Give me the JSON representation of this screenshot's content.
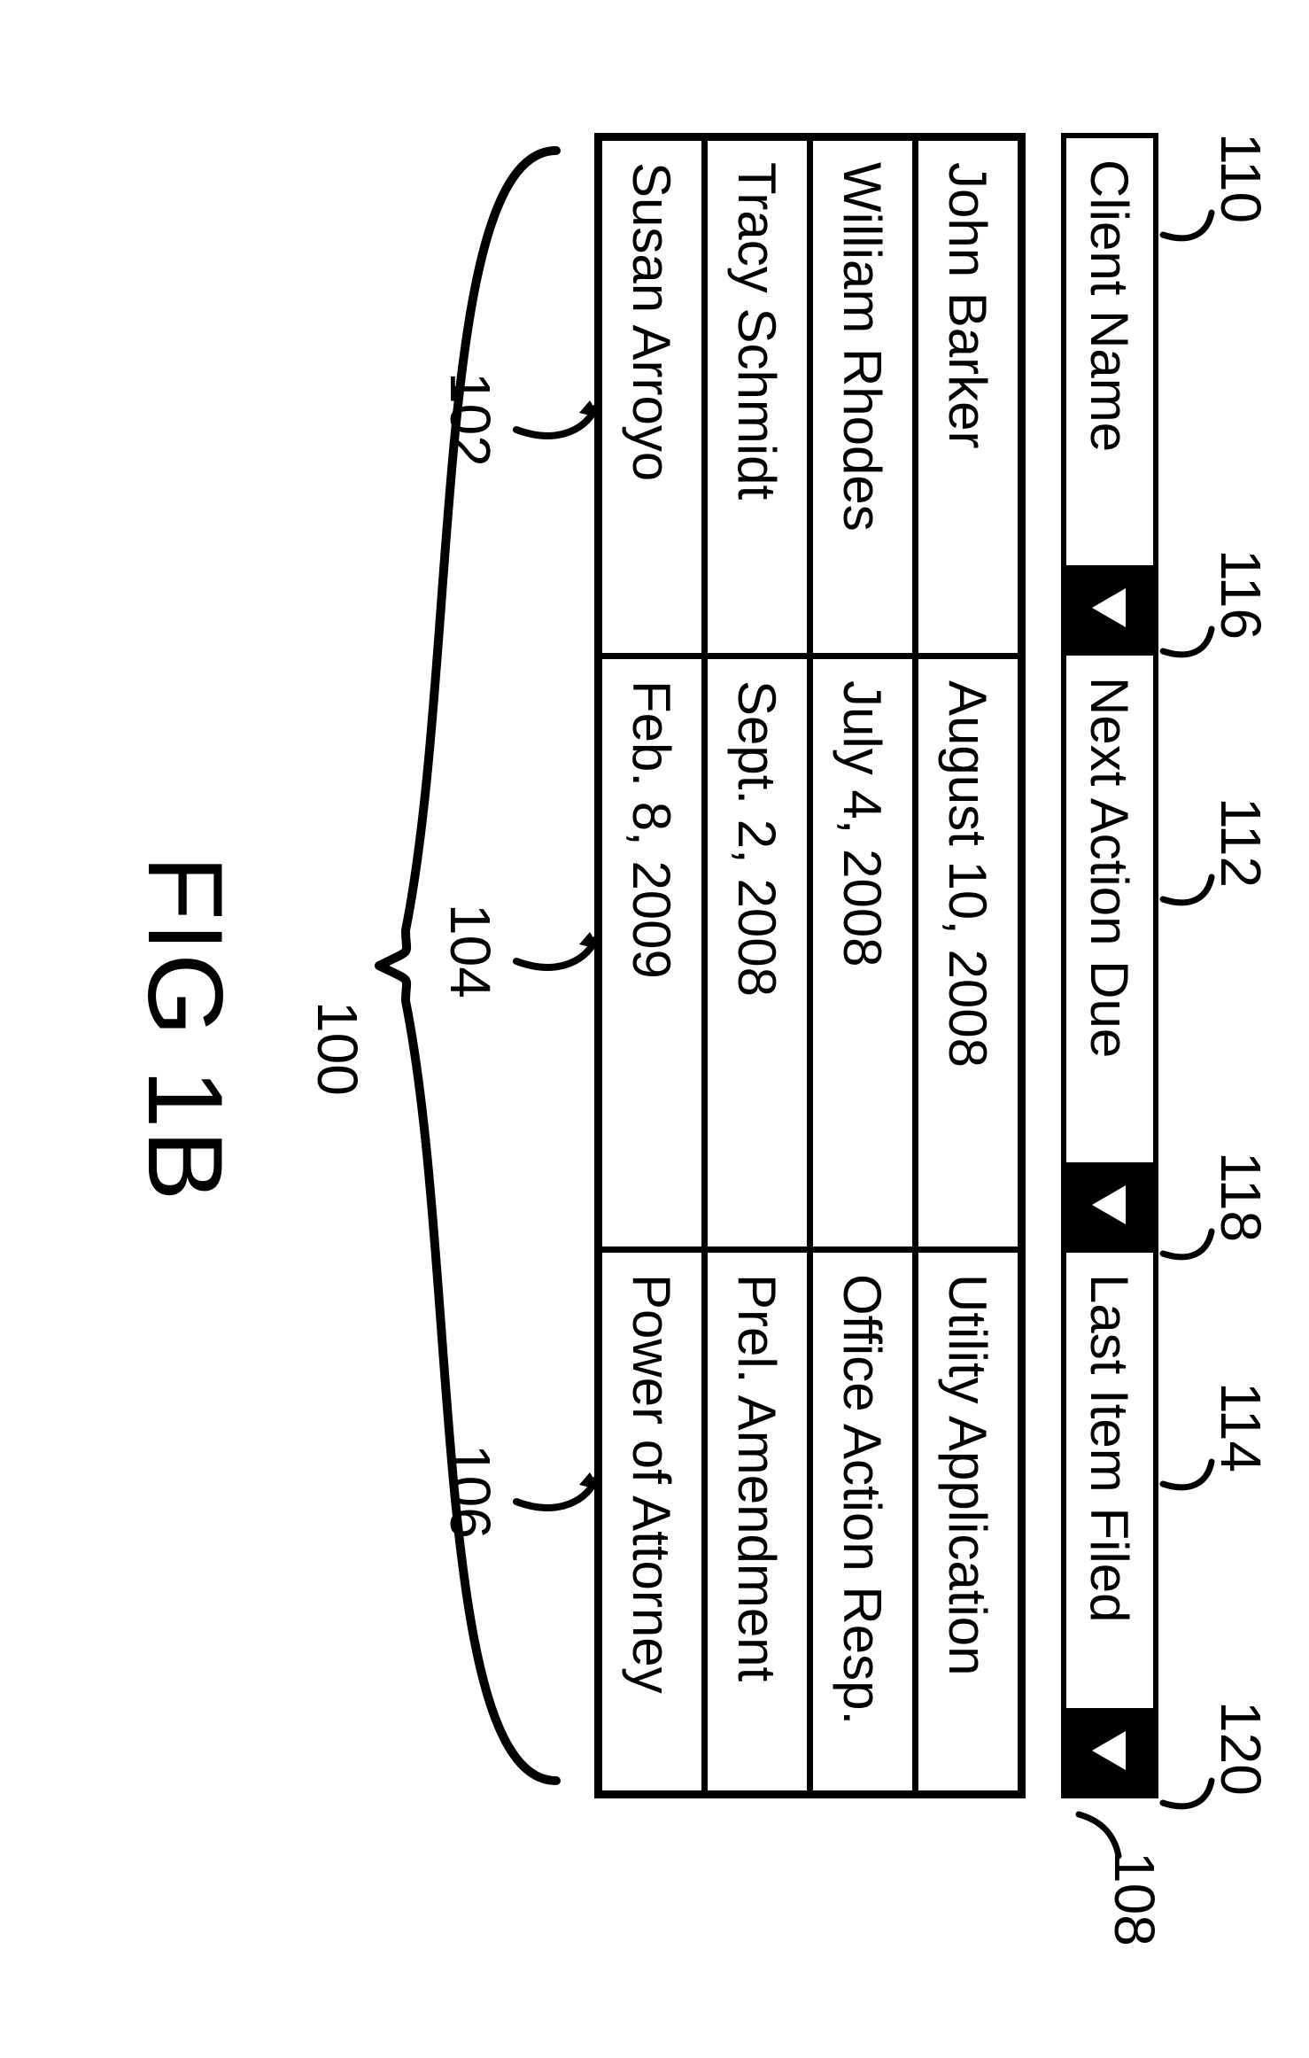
{
  "headers": {
    "client_name": "Client Name",
    "next_action_due": "Next Action Due",
    "last_item_filed": "Last Item Filed"
  },
  "rows": [
    {
      "client": "John Barker",
      "due": "August 10, 2008",
      "filed": "Utility Application"
    },
    {
      "client": "William Rhodes",
      "due": "July 4, 2008",
      "filed": "Office Action Resp."
    },
    {
      "client": "Tracy Schmidt",
      "due": "Sept. 2, 2008",
      "filed": "Prel. Amendment"
    },
    {
      "client": "Susan Arroyo",
      "due": "Feb. 8, 2009",
      "filed": "Power of Attorney"
    }
  ],
  "refs": {
    "r100": "100",
    "r102": "102",
    "r104": "104",
    "r106": "106",
    "r108": "108",
    "r110": "110",
    "r112": "112",
    "r114": "114",
    "r116": "116",
    "r118": "118",
    "r120": "120"
  },
  "figure_label": "FIG 1B"
}
